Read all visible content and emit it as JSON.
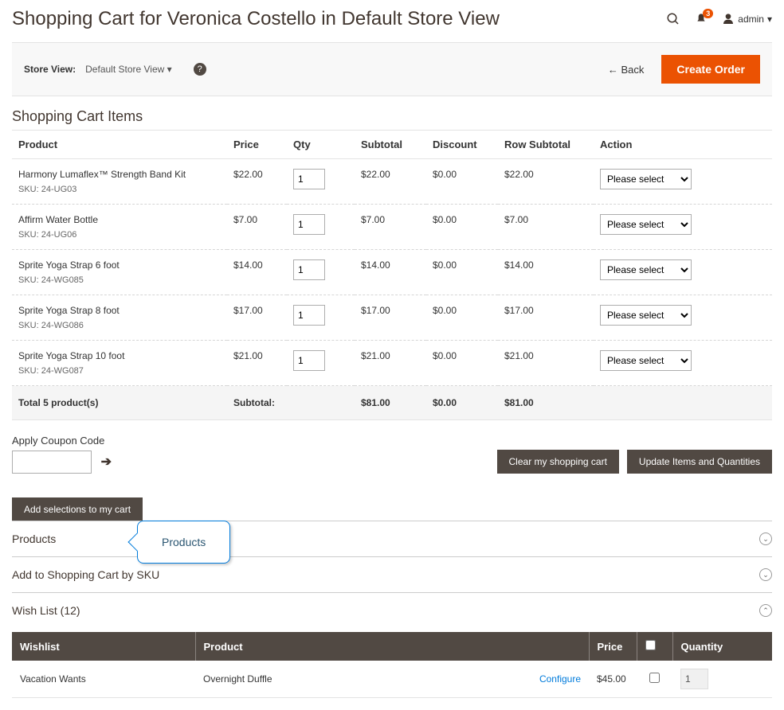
{
  "header": {
    "title": "Shopping Cart for Veronica Costello in Default Store View",
    "notif_count": "3",
    "admin_label": "admin"
  },
  "toolbar": {
    "store_view_label": "Store View:",
    "store_view_value": "Default Store View",
    "back_label": "Back",
    "create_order_label": "Create Order"
  },
  "cart": {
    "section_title": "Shopping Cart Items",
    "headers": {
      "product": "Product",
      "price": "Price",
      "qty": "Qty",
      "subtotal": "Subtotal",
      "discount": "Discount",
      "row_subtotal": "Row Subtotal",
      "action": "Action"
    },
    "items": [
      {
        "name": "Harmony Lumaflex™ Strength Band Kit",
        "sku": "SKU: 24-UG03",
        "price": "$22.00",
        "qty": "1",
        "subtotal": "$22.00",
        "discount": "$0.00",
        "row_subtotal": "$22.00"
      },
      {
        "name": "Affirm Water Bottle",
        "sku": "SKU: 24-UG06",
        "price": "$7.00",
        "qty": "1",
        "subtotal": "$7.00",
        "discount": "$0.00",
        "row_subtotal": "$7.00"
      },
      {
        "name": "Sprite Yoga Strap 6 foot",
        "sku": "SKU: 24-WG085",
        "price": "$14.00",
        "qty": "1",
        "subtotal": "$14.00",
        "discount": "$0.00",
        "row_subtotal": "$14.00"
      },
      {
        "name": "Sprite Yoga Strap 8 foot",
        "sku": "SKU: 24-WG086",
        "price": "$17.00",
        "qty": "1",
        "subtotal": "$17.00",
        "discount": "$0.00",
        "row_subtotal": "$17.00"
      },
      {
        "name": "Sprite Yoga Strap 10 foot",
        "sku": "SKU: 24-WG087",
        "price": "$21.00",
        "qty": "1",
        "subtotal": "$21.00",
        "discount": "$0.00",
        "row_subtotal": "$21.00"
      }
    ],
    "totals": {
      "label": "Total 5 product(s)",
      "subtotal_label": "Subtotal:",
      "subtotal": "$81.00",
      "discount": "$0.00",
      "row_subtotal": "$81.00"
    },
    "action_placeholder": "Please select"
  },
  "coupon": {
    "label": "Apply Coupon Code",
    "clear_label": "Clear my shopping cart",
    "update_label": "Update Items and Quantities"
  },
  "add_selections_label": "Add selections to my cart",
  "accordions": {
    "products": "Products",
    "tooltip_text": "Products",
    "add_by_sku": "Add to Shopping Cart by SKU",
    "wishlist": "Wish List (12)"
  },
  "wishlist": {
    "headers": {
      "wishlist": "Wishlist",
      "product": "Product",
      "price": "Price",
      "quantity": "Quantity"
    },
    "rows": [
      {
        "wishlist": "Vacation Wants",
        "product": "Overnight Duffle",
        "configure": "Configure",
        "price": "$45.00",
        "qty": "1"
      }
    ]
  }
}
